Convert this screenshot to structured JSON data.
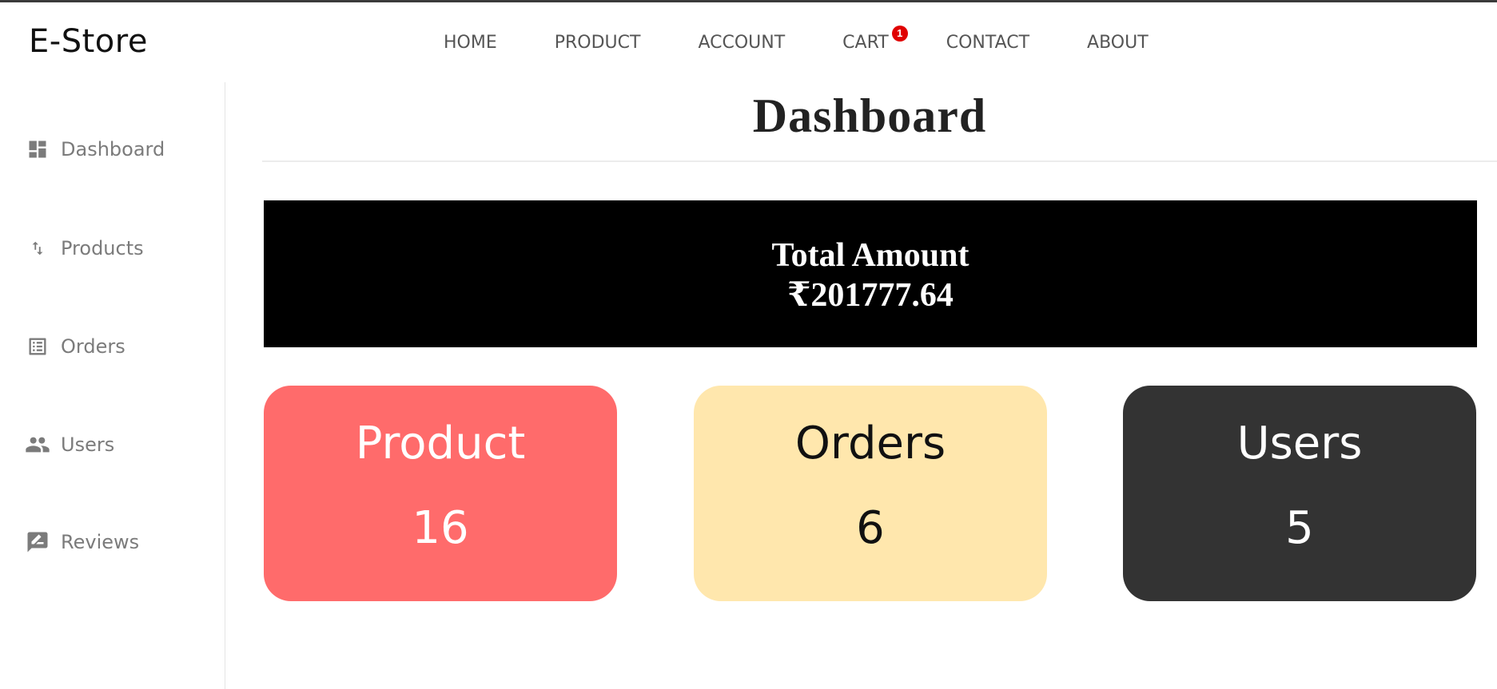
{
  "brand": {
    "name": "E-Store"
  },
  "nav": {
    "items": [
      {
        "label": "HOME"
      },
      {
        "label": "PRODUCT"
      },
      {
        "label": "ACCOUNT"
      },
      {
        "label": "CART",
        "badge": "1"
      },
      {
        "label": "CONTACT"
      },
      {
        "label": "ABOUT"
      }
    ]
  },
  "sidebar": {
    "items": [
      {
        "label": "Dashboard",
        "icon": "dashboard-icon"
      },
      {
        "label": "Products",
        "icon": "sort-arrows-icon"
      },
      {
        "label": "Orders",
        "icon": "list-alt-icon"
      },
      {
        "label": "Users",
        "icon": "people-icon"
      },
      {
        "label": "Reviews",
        "icon": "rate-review-icon"
      }
    ]
  },
  "main": {
    "title": "Dashboard",
    "total": {
      "label": "Total Amount",
      "value": "₹201777.64"
    },
    "cards": [
      {
        "title": "Product",
        "value": "16"
      },
      {
        "title": "Orders",
        "value": "6"
      },
      {
        "title": "Users",
        "value": "5"
      }
    ]
  },
  "colors": {
    "product_card": "#ff6b6b",
    "orders_card": "#ffe7ad",
    "users_card": "#333333",
    "total_box": "#000000",
    "cart_badge": "#e00000"
  }
}
